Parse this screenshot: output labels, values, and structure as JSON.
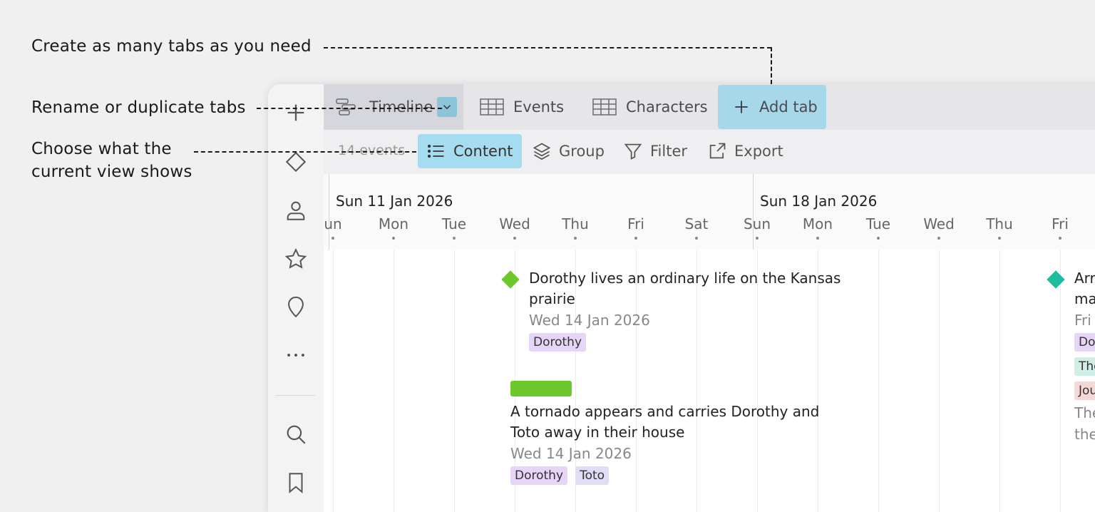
{
  "annotations": {
    "tabs": "Create as many tabs as you need",
    "rename": "Rename or duplicate tabs",
    "view_line1": "Choose what the",
    "view_line2": "current view shows"
  },
  "tabs": {
    "timeline": "Timeline",
    "events": "Events",
    "characters": "Characters",
    "add": "Add tab"
  },
  "toolbar": {
    "count": "14 events",
    "content": "Content",
    "group": "Group",
    "filter": "Filter",
    "export": "Export"
  },
  "timeline": {
    "week1": "Sun 11 Jan 2026",
    "week2": "Sun 18 Jan 2026",
    "days": [
      "un",
      "Mon",
      "Tue",
      "Wed",
      "Thu",
      "Fri",
      "Sat",
      "Sun",
      "Mon",
      "Tue",
      "Wed",
      "Thu",
      "Fri"
    ]
  },
  "events": [
    {
      "title_line1": "Dorothy lives an ordinary life on the Kansas",
      "title_line2": "prairie",
      "date": "Wed 14 Jan 2026",
      "tags": [
        "Dorothy"
      ],
      "color": "#6ec82c"
    },
    {
      "title_line1": "A tornado appears and carries Dorothy and",
      "title_line2": "Toto away in their house",
      "date": "Wed 14 Jan 2026",
      "tags": [
        "Dorothy",
        "Toto"
      ],
      "color": "#6ec82c"
    },
    {
      "title_line1": "Arr",
      "title_line2": "ma",
      "date": "Fri",
      "tags": [
        "Do",
        "The",
        "Jou"
      ],
      "desc_line1": "The",
      "desc_line2": "the",
      "color": "#1dbd9f"
    }
  ],
  "colors": {
    "accent": "#a5dcef",
    "green": "#6ec82c",
    "teal": "#1dbd9f"
  }
}
